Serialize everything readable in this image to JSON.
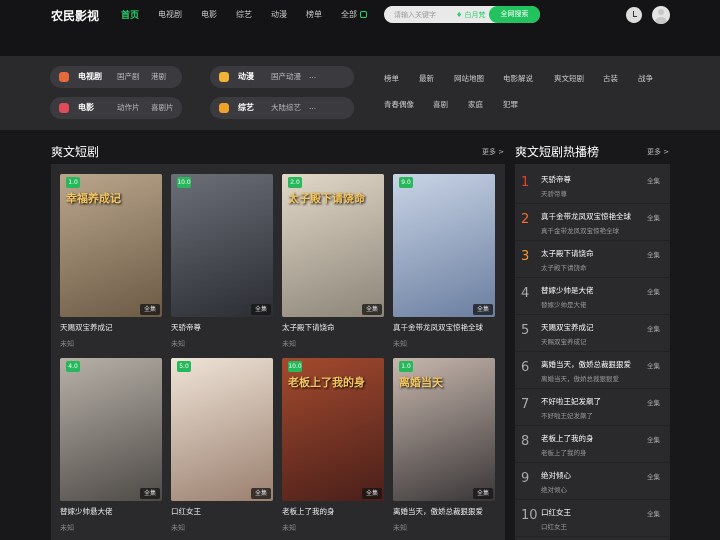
{
  "header": {
    "logo": "农民影视",
    "nav": [
      "首页",
      "电视剧",
      "电影",
      "综艺",
      "动漫",
      "榜单",
      "全部"
    ],
    "search_placeholder": "请输入关键字",
    "hot_label": "♦ 白月梵",
    "search_button": "全网搜索"
  },
  "categories": {
    "pills": [
      {
        "name": "电视剧",
        "subs": [
          "国产剧",
          "港剧"
        ],
        "icon_color": "#e56a3a",
        "icon": "tv-icon"
      },
      {
        "name": "动漫",
        "subs": [
          "国产动漫",
          "..."
        ],
        "icon_color": "#f2b233",
        "icon": "cat-face-icon"
      },
      {
        "name": "电影",
        "subs": [
          "动作片",
          "喜剧片"
        ],
        "icon_color": "#e04b5a",
        "icon": "film-icon"
      },
      {
        "name": "综艺",
        "subs": [
          "大陆综艺",
          "..."
        ],
        "icon_color": "#f0a12a",
        "icon": "mic-icon"
      }
    ],
    "links": [
      "榜单",
      "最新",
      "网站地图",
      "电影解说",
      "爽文短剧",
      "古装",
      "战争",
      "青春偶像",
      "喜剧",
      "家庭",
      "犯罪"
    ]
  },
  "main": {
    "title": "爽文短剧",
    "more": "更多 >",
    "cards": [
      {
        "title": "天赐双宝养成记",
        "sub": "未知",
        "score": "1.0",
        "tag": "全集",
        "poster_text": "幸福养成记",
        "bg": [
          "#6d5a45",
          "#b9a68c"
        ]
      },
      {
        "title": "天骄帝尊",
        "sub": "未知",
        "score": "10.0",
        "tag": "全集",
        "poster_text": "",
        "bg": [
          "#2b2d33",
          "#6c6f78"
        ]
      },
      {
        "title": "太子殿下请饶命",
        "sub": "未知",
        "score": "2.0",
        "tag": "全集",
        "poster_text": "太子殿下请饶命",
        "bg": [
          "#8c8578",
          "#e2d8c8"
        ]
      },
      {
        "title": "真千金带龙凤双宝惊艳全球",
        "sub": "未知",
        "score": "9.0",
        "tag": "全集",
        "poster_text": "",
        "bg": [
          "#6a7ea0",
          "#c9d4e6"
        ]
      },
      {
        "title": "替嫁少帅悬大佬",
        "sub": "未知",
        "score": "4.0",
        "tag": "全集",
        "poster_text": "",
        "bg": [
          "#4e4a46",
          "#b7b1a8"
        ]
      },
      {
        "title": "口红女王",
        "sub": "未知",
        "score": "5.0",
        "tag": "全集",
        "poster_text": "",
        "bg": [
          "#9a7f6e",
          "#efe4d8"
        ]
      },
      {
        "title": "老板上了我的身",
        "sub": "未知",
        "score": "10.0",
        "tag": "全集",
        "poster_text": "老板上了我的身",
        "bg": [
          "#4a1f1a",
          "#a34a2e"
        ]
      },
      {
        "title": "离婚当天，傲娇总裁狠狠爱",
        "sub": "未知",
        "score": "1.0",
        "tag": "全集",
        "poster_text": "离婚当天",
        "bg": [
          "#3a3638",
          "#c7b7ad"
        ]
      }
    ]
  },
  "ranking": {
    "title": "爽文短剧热播榜",
    "more": "更多 >",
    "items": [
      {
        "num": "1",
        "title": "天骄帝尊",
        "sub": "天骄帝尊",
        "tag": "全集"
      },
      {
        "num": "2",
        "title": "真千金带龙凤双宝惊艳全球",
        "sub": "真千金带龙凤双宝惊艳全球",
        "tag": "全集"
      },
      {
        "num": "3",
        "title": "太子殿下请饶命",
        "sub": "太子殿下请饶命",
        "tag": "全集"
      },
      {
        "num": "4",
        "title": "替嫁少帅是大佬",
        "sub": "替嫁少帅是大佬",
        "tag": "全集"
      },
      {
        "num": "5",
        "title": "天赐双宝养成记",
        "sub": "天赐双宝养成记",
        "tag": "全集"
      },
      {
        "num": "6",
        "title": "离婚当天，傲娇总裁狠狠爱",
        "sub": "离婚当天，傲娇总裁狠狠爱",
        "tag": "全集"
      },
      {
        "num": "7",
        "title": "不好啦王妃发飙了",
        "sub": "不好啦王妃发飙了",
        "tag": "全集"
      },
      {
        "num": "8",
        "title": "老板上了我的身",
        "sub": "老板上了我的身",
        "tag": "全集"
      },
      {
        "num": "9",
        "title": "绝对倾心",
        "sub": "绝对倾心",
        "tag": "全集"
      },
      {
        "num": "10",
        "title": "口红女王",
        "sub": "口红女王",
        "tag": "全集"
      }
    ]
  }
}
